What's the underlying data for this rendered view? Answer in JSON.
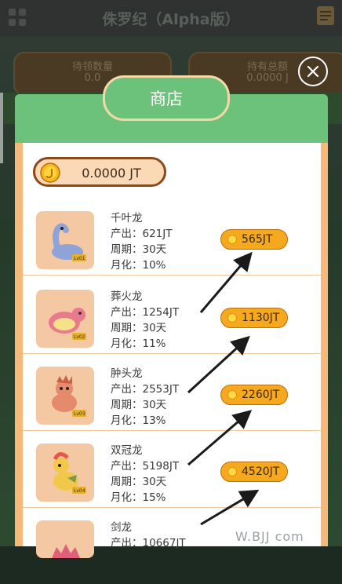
{
  "app": {
    "title": "侏罗纪（Alpha版）"
  },
  "background": {
    "card_left": {
      "title": "待领数量",
      "value": "0.0"
    },
    "card_right": {
      "title": "持有总额",
      "value": "0.0000 J"
    }
  },
  "modal": {
    "title": "商店",
    "balance": "0.0000 JT",
    "items": [
      {
        "name": "千叶龙",
        "output": "产出：621JT",
        "period": "周期：30天",
        "monthly": "月化：10%",
        "price": "565JT",
        "level": "Lv01",
        "color": "#8fa3d9"
      },
      {
        "name": "葬火龙",
        "output": "产出：1254JT",
        "period": "周期：30天",
        "monthly": "月化：11%",
        "price": "1130JT",
        "level": "Lv02",
        "color": "#e97a8e"
      },
      {
        "name": "肿头龙",
        "output": "产出：2553JT",
        "period": "周期：30天",
        "monthly": "月化：13%",
        "price": "2260JT",
        "level": "Lv03",
        "color": "#e58a6a"
      },
      {
        "name": "双冠龙",
        "output": "产出：5198JT",
        "period": "周期：30天",
        "monthly": "月化：15%",
        "price": "4520JT",
        "level": "Lv04",
        "color": "#f2c84a"
      },
      {
        "name": "剑龙",
        "output": "产出：10667JT",
        "period": "",
        "monthly": "",
        "price": "",
        "level": "",
        "color": "#e0607a"
      }
    ]
  },
  "watermark": "W.BJJ  com",
  "icons": {
    "close": "close-icon",
    "coin": "coin-icon",
    "menu": "grid-icon",
    "note": "note-icon"
  }
}
